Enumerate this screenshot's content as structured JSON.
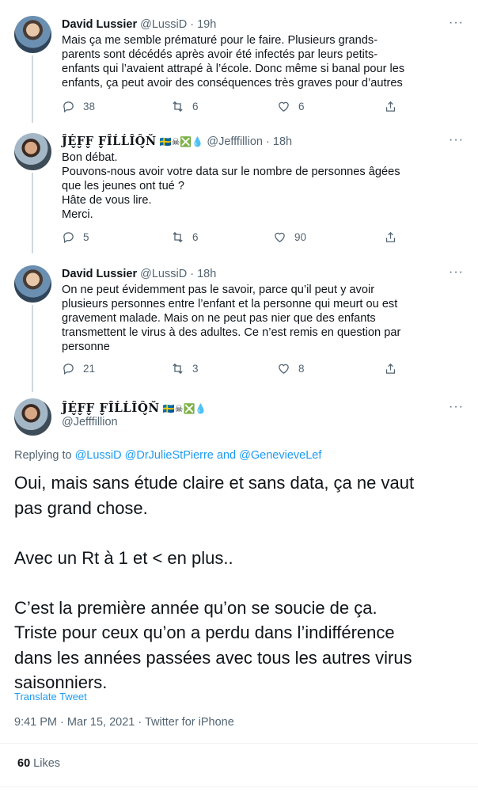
{
  "tweets": [
    {
      "name": "David Lussier",
      "handle": "@LussiD",
      "time": "19h",
      "text": "Mais ça me semble prématuré pour le faire. Plusieurs grands-\nparents sont décédés après avoir été infectés par leurs petits-\nenfants qui l’avaient attrapé à l’école. Donc même si banal pour les\nenfants, ça peut avoir des conséquences très graves pour d’autres",
      "replies": "38",
      "retweets": "6",
      "likes": "6"
    },
    {
      "name": "ĴÉ̬F̬F̬ F̬ÎĹĹÎÔ̬Ň",
      "flags": "🇸🇪☠❎💧",
      "handle": "@Jefffillion",
      "time": "18h",
      "text": "Bon débat.\nPouvons-nous avoir votre data sur le nombre de personnes âgées\nque les jeunes ont tué ?\nHâte de vous lire.\nMerci.",
      "replies": "5",
      "retweets": "6",
      "likes": "90"
    },
    {
      "name": "David Lussier",
      "handle": "@LussiD",
      "time": "18h",
      "text": "On ne peut évidemment pas le savoir, parce qu’il peut y avoir\nplusieurs personnes entre l’enfant et la personne qui meurt ou est\ngravement malade. Mais on ne peut pas nier que des enfants\ntransmettent le virus à des adultes. Ce n’est remis en question par\npersonne",
      "replies": "21",
      "retweets": "3",
      "likes": "8"
    }
  ],
  "main": {
    "name": "ĴÉ̬F̬F̬ F̬ÎĹĹÎÔ̬Ň",
    "flags": "🇸🇪☠❎💧",
    "handle": "@Jefffillion",
    "replying_prefix": "Replying to",
    "replying_to": [
      "@LussiD",
      "@DrJulieStPierre",
      "@GenevieveLef"
    ],
    "replying_and": "and",
    "text": "Oui, mais sans étude claire et sans data, ça ne vaut\npas grand chose.\n\nAvec un Rt à 1 et < en plus..\n\nC’est la première année qu’on se soucie de ça.\nTriste pour ceux qu’on a perdu dans l’indifférence\ndans les années passées avec tous les autres virus\nsaisonniers.",
    "translate": "Translate Tweet",
    "meta": "9:41 PM · Mar 15, 2021 · Twitter for iPhone",
    "like_count": "60",
    "like_label": "Likes"
  },
  "icons": {
    "more": "more-icon",
    "reply": "reply-icon",
    "retweet": "retweet-icon",
    "like": "heart-icon",
    "share": "share-icon"
  },
  "colors": {
    "link": "#1d9bf0",
    "secondary": "#536471",
    "text": "#0f1419"
  }
}
